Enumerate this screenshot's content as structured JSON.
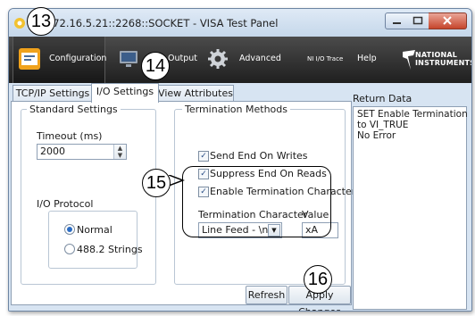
{
  "window": {
    "title": ":172.16.5.21::2268::SOCKET - VISA Test Panel"
  },
  "toolbar": {
    "items": [
      {
        "label": "Configuration",
        "icon": "configuration-icon"
      },
      {
        "label": "",
        "icon": "monitor-icon"
      },
      {
        "label": "Output",
        "icon": "output-icon"
      },
      {
        "label": "Advanced",
        "icon": "gear-icon"
      },
      {
        "label": "NI I/O Trace",
        "icon": ""
      },
      {
        "label": "Help",
        "icon": ""
      }
    ],
    "logo_line1": "NATIONAL",
    "logo_line2": "INSTRUMENTS"
  },
  "tabs": [
    "TCP/IP Settings",
    "I/O Settings",
    "View Attributes"
  ],
  "standard_settings": {
    "title": "Standard Settings",
    "timeout_label": "Timeout (ms)",
    "timeout_value": "2000",
    "io_protocol_label": "I/O Protocol",
    "protocol_options": [
      "Normal",
      "488.2 Strings"
    ],
    "selected_protocol": "Normal"
  },
  "termination": {
    "title": "Termination Methods",
    "send_end_on_writes": {
      "label": "Send End On Writes",
      "checked": true
    },
    "suppress_end_on_reads": {
      "label": "Suppress End On Reads",
      "checked": true
    },
    "enable_term_char": {
      "label": "Enable Termination Character",
      "checked": true
    },
    "term_char_label": "Termination Character",
    "term_char_value": "Line Feed - \\n",
    "value_label": "Value",
    "value_value": "xA"
  },
  "buttons": {
    "refresh": "Refresh",
    "apply": "Apply Changes"
  },
  "return_data": {
    "title": "Return Data",
    "lines": [
      "SET Enable Termination",
      "to VI_TRUE",
      "No Error"
    ]
  },
  "callouts": [
    "13",
    "14",
    "15",
    "16"
  ]
}
